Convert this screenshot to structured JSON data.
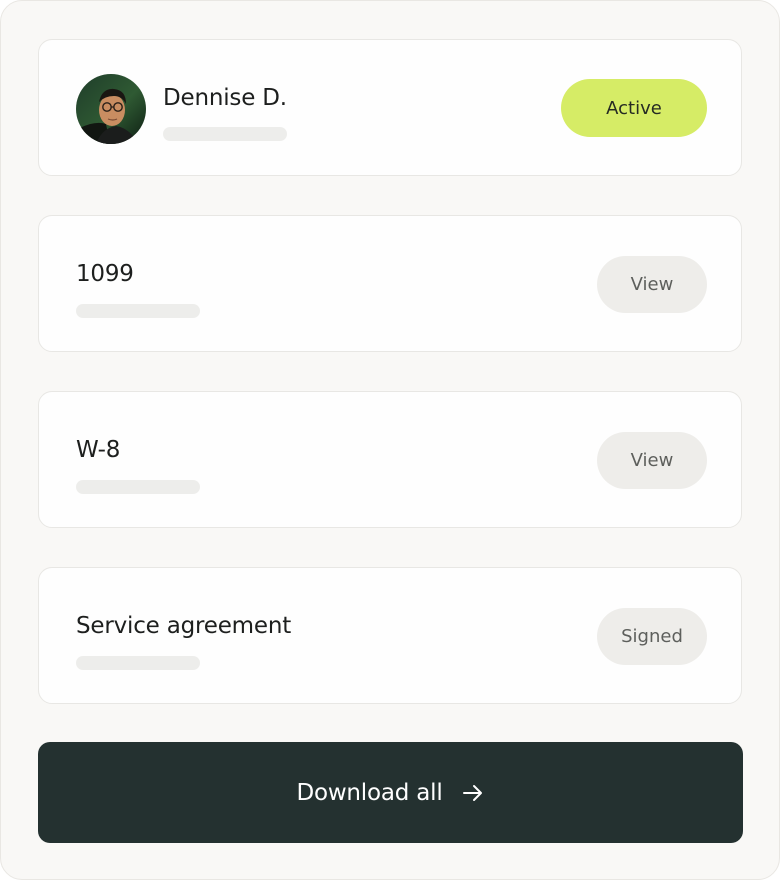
{
  "profile": {
    "name": "Dennise D.",
    "status": "Active",
    "status_color": "#d6ec66"
  },
  "documents": [
    {
      "title": "1099",
      "action": "View"
    },
    {
      "title": "W-8",
      "action": "View"
    },
    {
      "title": "Service agreement",
      "action": "Signed"
    }
  ],
  "footer": {
    "download_label": "Download all",
    "download_icon": "arrow-right-icon",
    "button_color": "#243130"
  }
}
